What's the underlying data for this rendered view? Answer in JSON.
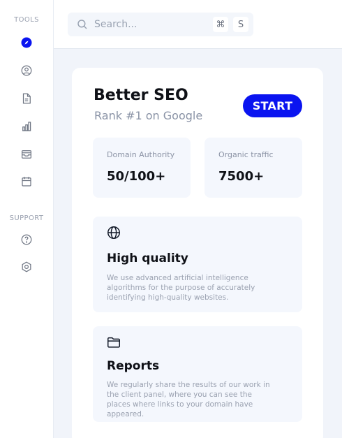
{
  "sidebar": {
    "tools_label": "TOOLS",
    "support_label": "SUPPORT",
    "items": [
      {
        "icon": "compass-icon",
        "active": true
      },
      {
        "icon": "user-circle-icon"
      },
      {
        "icon": "document-icon"
      },
      {
        "icon": "bar-chart-icon"
      },
      {
        "icon": "inbox-icon"
      },
      {
        "icon": "calendar-icon"
      }
    ],
    "support_items": [
      {
        "icon": "help-icon"
      },
      {
        "icon": "settings-icon"
      }
    ]
  },
  "search": {
    "placeholder": "Search...",
    "shortcut_mod": "⌘",
    "shortcut_key": "S"
  },
  "hero": {
    "title": "Better SEO",
    "subtitle": "Rank #1 on Google",
    "start_label": "START"
  },
  "stats": [
    {
      "label": "Domain Authority",
      "value": "50/100+"
    },
    {
      "label": "Organic traffic",
      "value": "7500+"
    }
  ],
  "features": [
    {
      "icon": "globe-icon",
      "title": "High quality",
      "description": "We use advanced artificial intelligence algorithms for the purpose of accurately identifying high-quality websites."
    },
    {
      "icon": "folder-icon",
      "title": "Reports",
      "description": "We regularly share the results of our work in the client panel, where you can see the places where links to your domain have appeared."
    }
  ],
  "colors": {
    "accent": "#0a14f0",
    "sidebar_icon": "#6b7280",
    "background": "#f1f4fa"
  }
}
